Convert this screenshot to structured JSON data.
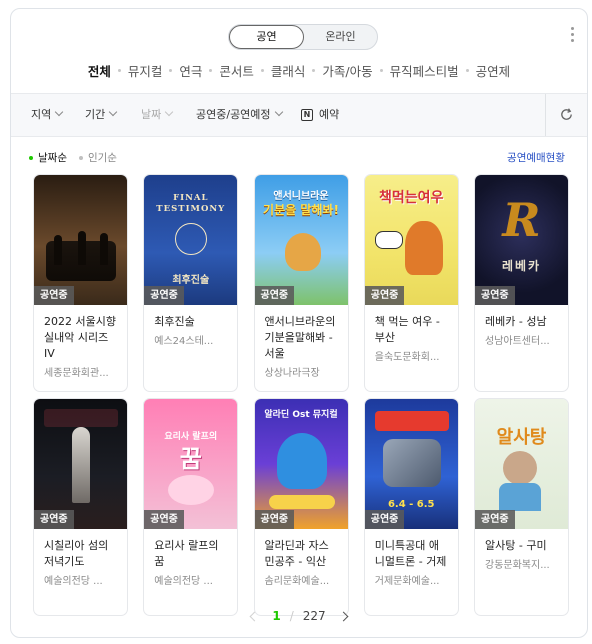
{
  "toggle": {
    "options": [
      "공연",
      "온라인"
    ],
    "selected": "공연"
  },
  "categories": [
    "전체",
    "뮤지컬",
    "연극",
    "콘서트",
    "클래식",
    "가족/아동",
    "뮤직페스티벌",
    "공연제"
  ],
  "category_active": "전체",
  "filters": {
    "region": "지역",
    "period": "기간",
    "date": "날짜",
    "status": "공연중/공연예정",
    "booking": "예약",
    "booking_icon_letter": "N"
  },
  "sort": {
    "options": [
      "날짜순",
      "인기순"
    ],
    "active": "날짜순"
  },
  "status_link": "공연예매현황",
  "badge_label": "공연중",
  "cards": [
    {
      "title": "2022 서울시향 실내악 시리즈 IV",
      "venue": "세종문화회관...",
      "poster_text": "",
      "poster_sub": ""
    },
    {
      "title": "최후진술",
      "venue": "예스24스테...",
      "poster_text": "FINAL TESTIMONY",
      "poster_sub": "최후진술"
    },
    {
      "title": "앤서니브라운의 기분을말해봐 - 서울",
      "venue": "상상나라극장",
      "poster_text": "앤서니브라운",
      "poster_sub": "기분을 말해봐!"
    },
    {
      "title": "책 먹는 여우 - 부산",
      "venue": "을숙도문화회...",
      "poster_text": "책먹는여우",
      "poster_sub": ""
    },
    {
      "title": "레베카 - 성남",
      "venue": "성남아트센터...",
      "poster_text": "R",
      "poster_sub": "레베카"
    },
    {
      "title": "시칠리아 섬의 저녁기도",
      "venue": "예술의전당 ...",
      "poster_text": "",
      "poster_sub": ""
    },
    {
      "title": "요리사 랄프의 꿈",
      "venue": "예술의전당 ...",
      "poster_text": "요리사 랄프의",
      "poster_sub": "꿈"
    },
    {
      "title": "알라딘과 자스 민공주 - 익산",
      "venue": "솜리문화예술...",
      "poster_text": "알라딘 Ost 뮤지컬",
      "poster_sub": ""
    },
    {
      "title": "미니특공대 애 니멀트론 - 거제",
      "venue": "거제문화예술...",
      "poster_text": "",
      "poster_sub": "6.4 - 6.5"
    },
    {
      "title": "알사탕 - 구미",
      "venue": "강동문화복지...",
      "poster_text": "알사탕",
      "poster_sub": ""
    }
  ],
  "pagination": {
    "current": "1",
    "separator": "/",
    "total": "227"
  }
}
